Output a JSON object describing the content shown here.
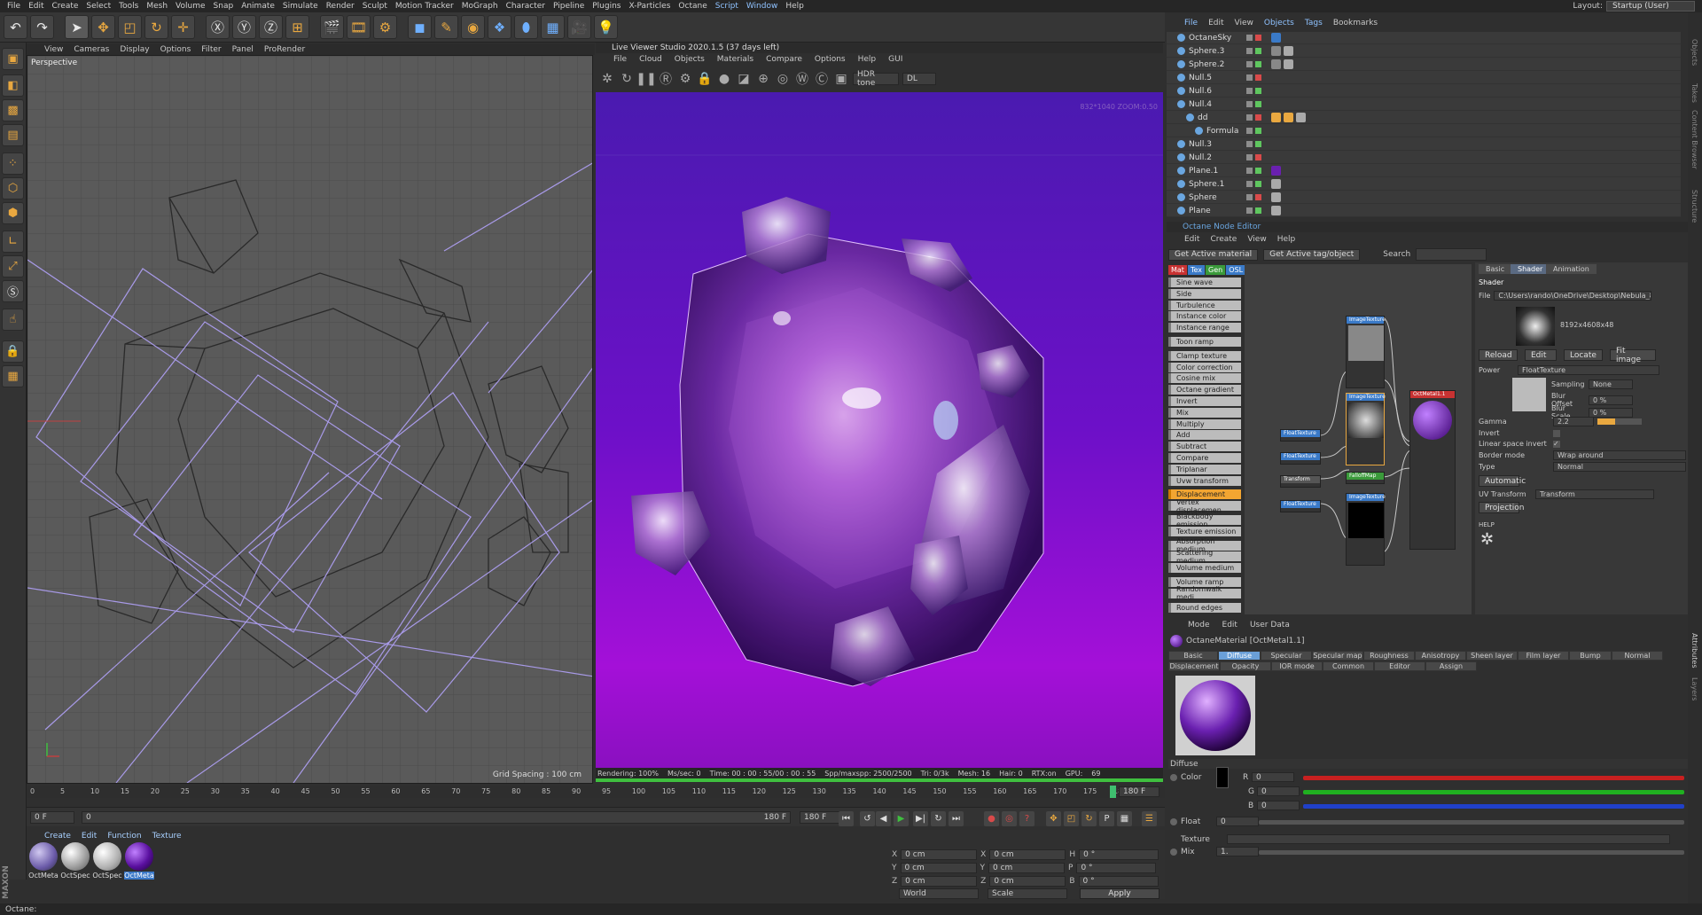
{
  "menubar": {
    "items": [
      "File",
      "Edit",
      "Create",
      "Select",
      "Tools",
      "Mesh",
      "Volume",
      "Snap",
      "Animate",
      "Simulate",
      "Render",
      "Sculpt",
      "Motion Tracker",
      "MoGraph",
      "Character",
      "Pipeline",
      "Plugins",
      "X-Particles",
      "Octane",
      "Script",
      "Window",
      "Help"
    ],
    "layout_label": "Layout:",
    "layout_value": "Startup (User)"
  },
  "viewport": {
    "menu": [
      "View",
      "Cameras",
      "Display",
      "Options",
      "Filter",
      "Panel",
      "ProRender"
    ],
    "label": "Perspective",
    "grid_spacing": "Grid Spacing : 100 cm"
  },
  "timeline": {
    "ticks": [
      "0",
      "5",
      "10",
      "15",
      "20",
      "25",
      "30",
      "35",
      "40",
      "45",
      "50",
      "55",
      "60",
      "65",
      "70",
      "75",
      "80",
      "85",
      "90",
      "95",
      "100",
      "105",
      "110",
      "115",
      "120",
      "125",
      "130",
      "135",
      "140",
      "145",
      "150",
      "155",
      "160",
      "165",
      "170",
      "175",
      "180"
    ],
    "current_frame": "180 F",
    "start": "0 F",
    "start2": "0",
    "end": "180 F",
    "end2": "180 F",
    "range_end_label": "180 F"
  },
  "materials": {
    "menu": [
      "Create",
      "Edit",
      "Function",
      "Texture"
    ],
    "items": [
      {
        "name": "OctMeta",
        "color": "#6a5aa8"
      },
      {
        "name": "OctSpec",
        "color": "#9a9a9a"
      },
      {
        "name": "OctSpec",
        "color": "#b0b0b0"
      },
      {
        "name": "OctMeta",
        "color": "#5a10a0"
      }
    ]
  },
  "coords": {
    "rows": [
      {
        "a": "X",
        "av": "0 cm",
        "b": "X",
        "bv": "0 cm",
        "c": "H",
        "cv": "0 °"
      },
      {
        "a": "Y",
        "av": "0 cm",
        "b": "Y",
        "bv": "0 cm",
        "c": "P",
        "cv": "0 °"
      },
      {
        "a": "Z",
        "av": "0 cm",
        "b": "Z",
        "bv": "0 cm",
        "c": "B",
        "cv": "0 °"
      }
    ],
    "mode1": "World",
    "mode2": "Scale",
    "apply": "Apply"
  },
  "status": {
    "text": "Octane:"
  },
  "live_viewer": {
    "title": "Live Viewer Studio 2020.1.5 (37 days left)",
    "menu": [
      "File",
      "Cloud",
      "Objects",
      "Materials",
      "Compare",
      "Options",
      "Help",
      "GUI"
    ],
    "tone": "HDR tone",
    "mode": "DL",
    "overlay": "832*1040 ZOOM:0.50",
    "status": [
      "Rendering: 100%",
      "Ms/sec: 0",
      "Time: 00 : 00 : 55/00 : 00 : 55",
      "Spp/maxspp: 2500/2500",
      "Tri: 0/3k",
      "Mesh: 16",
      "Hair: 0",
      "RTX:on",
      "GPU:",
      "69"
    ],
    "progress": 1.0
  },
  "object_manager": {
    "menu": [
      "File",
      "Edit",
      "View",
      "Objects",
      "Tags",
      "Bookmarks"
    ],
    "objects": [
      {
        "name": "OctaneSky",
        "indent": 0
      },
      {
        "name": "Sphere.3",
        "indent": 0
      },
      {
        "name": "Sphere.2",
        "indent": 0
      },
      {
        "name": "Null.5",
        "indent": 0
      },
      {
        "name": "Null.6",
        "indent": 0
      },
      {
        "name": "Null.4",
        "indent": 0
      },
      {
        "name": "dd",
        "indent": 1
      },
      {
        "name": "Formula",
        "indent": 2
      },
      {
        "name": "Null.3",
        "indent": 0
      },
      {
        "name": "Null.2",
        "indent": 0
      },
      {
        "name": "Plane.1",
        "indent": 0
      },
      {
        "name": "Sphere.1",
        "indent": 0
      },
      {
        "name": "Sphere",
        "indent": 0
      },
      {
        "name": "Plane",
        "indent": 0
      }
    ]
  },
  "node_editor": {
    "title": "Octane Node Editor",
    "menu": [
      "Edit",
      "Create",
      "View",
      "Help"
    ],
    "get_material": "Get Active material",
    "get_tag": "Get Active tag/object",
    "search": "Search",
    "categories": [
      {
        "label": "Mat",
        "color": "#c83232"
      },
      {
        "label": "Tex",
        "color": "#3a7ac8"
      },
      {
        "label": "Gen",
        "color": "#3a9a3a"
      },
      {
        "label": "OSL",
        "color": "#3a7ac8"
      },
      {
        "label": "Map",
        "color": "#c83232"
      },
      {
        "label": "Oth",
        "color": "#555555"
      },
      {
        "label": "Ems",
        "color": "#3a5aa8"
      },
      {
        "label": "Med",
        "color": "#2a9a8a"
      },
      {
        "label": "C4D",
        "color": "#222222"
      }
    ],
    "nodes": [
      "Sine wave",
      "Side",
      "Turbulence",
      "Instance color",
      "Instance range",
      "Toon ramp",
      "Clamp texture",
      "Color correction",
      "Cosine mix",
      "Octane gradient",
      "Invert",
      "Mix",
      "Multiply",
      "Add",
      "Subtract",
      "Compare",
      "Triplanar",
      "Uvw transform",
      "Displacement",
      "Vertex displacemen",
      "Blackbody emission",
      "Texture emission",
      "Absorption medium",
      "Scattering medium",
      "Volume medium",
      "Volume ramp",
      "Randomwalk medi",
      "Round edges"
    ],
    "highlighted": "Displacement",
    "graph_nodes": [
      "ImageTexture",
      "ImageTexture",
      "FalloffMap",
      "ImageTexture",
      "OctMetal1.1",
      "FloatTexture",
      "FloatTexture",
      "Transform",
      "FloatTexture"
    ]
  },
  "shader_panel": {
    "tabs": [
      "Basic",
      "Shader",
      "Animation"
    ],
    "section": "Shader",
    "file_label": "File",
    "file_path": "C:\\Users\\rando\\OneDrive\\Desktop\\Nebula_8k",
    "resolution": "8192x4608x48",
    "buttons": [
      "Reload",
      "Edit",
      "Locate",
      "Fit image"
    ],
    "power_label": "Power",
    "power_value": "FloatTexture",
    "sampling_label": "Sampling",
    "sampling_value": "None",
    "blur_offset_label": "Blur Offset",
    "blur_offset_value": "0 %",
    "blur_scale_label": "Blur Scale",
    "blur_scale_value": "0 %",
    "gamma_label": "Gamma",
    "gamma_value": "2.2",
    "invert_label": "Invert",
    "linear_label": "Linear space invert",
    "border_label": "Border mode",
    "border_value": "Wrap around",
    "type_label": "Type",
    "type_value": "Normal",
    "automatic": "Automatic",
    "uv_label": "UV Transform",
    "uv_value": "Transform",
    "projection": "Projection",
    "help": "HELP"
  },
  "attribute_manager": {
    "menu": [
      "Mode",
      "Edit",
      "User Data"
    ],
    "title": "OctaneMaterial [OctMetal1.1]",
    "tabs_row1": [
      "Basic",
      "Diffuse",
      "Specular",
      "Specular map",
      "Roughness",
      "Anisotropy",
      "Sheen layer",
      "Film layer",
      "Bump",
      "Normal"
    ],
    "tabs_row2": [
      "Displacement",
      "Opacity",
      "IOR mode",
      "Common",
      "Editor",
      "Assign"
    ],
    "selected_tab": "Diffuse",
    "section": "Diffuse",
    "color_label": "Color",
    "r_label": "R",
    "r_value": "0",
    "g_label": "G",
    "g_value": "0",
    "b_label": "B",
    "b_value": "0",
    "float_label": "Float",
    "float_value": "0",
    "texture_label": "Texture",
    "mix_label": "Mix",
    "mix_value": "1.",
    "colors": {
      "red": "#c82020",
      "green": "#20b020",
      "blue": "#2040c8"
    }
  },
  "right_strip": [
    "Objects",
    "Takes",
    "Content Browser",
    "Structure",
    "Attributes",
    "Layers"
  ]
}
